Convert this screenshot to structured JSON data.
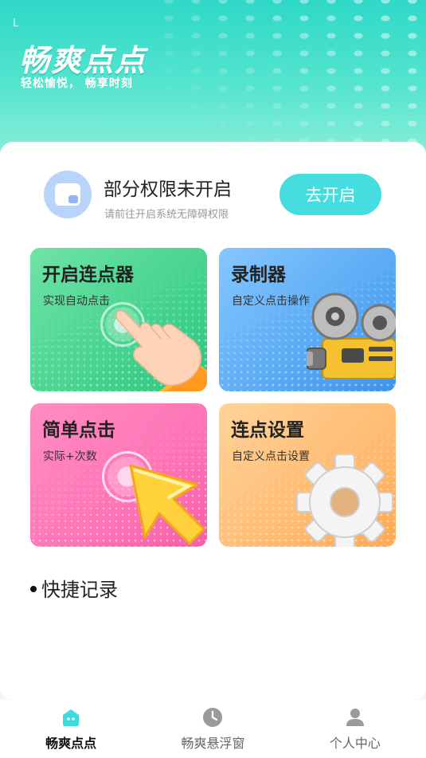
{
  "status_bar": {
    "mark": "L"
  },
  "header": {
    "title": "畅爽点点",
    "subtitle": "轻松愉悦， 畅享时刻"
  },
  "permission": {
    "title": "部分权限未开启",
    "description": "请前往开启系统无障碍权限",
    "button_label": "去开启",
    "icon": "window-app-icon"
  },
  "features": [
    {
      "title": "开启连点器",
      "description": "实现自动点击",
      "icon": "tap-hand-icon",
      "color": "#45d38e"
    },
    {
      "title": "录制器",
      "description": "自定义点击操作",
      "icon": "film-camera-icon",
      "color": "#58a9f4"
    },
    {
      "title": "简单点击",
      "description": "实际+次数",
      "icon": "cursor-arrow-icon",
      "color": "#ff74b6"
    },
    {
      "title": "连点设置",
      "description": "自定义点击设置",
      "icon": "gear-icon",
      "color": "#ffbb72"
    }
  ],
  "quick_record": {
    "label": "快捷记录"
  },
  "nav": {
    "items": [
      {
        "label": "畅爽点点",
        "icon": "home-robot-icon",
        "active": true
      },
      {
        "label": "畅爽悬浮窗",
        "icon": "clock-icon",
        "active": false
      },
      {
        "label": "个人中心",
        "icon": "person-icon",
        "active": false
      }
    ]
  },
  "colors": {
    "header_teal": "#2fd8c8",
    "accent_button": "#46dde0",
    "nav_active_icon": "#3ddbe0",
    "nav_inactive_icon": "#999999"
  }
}
